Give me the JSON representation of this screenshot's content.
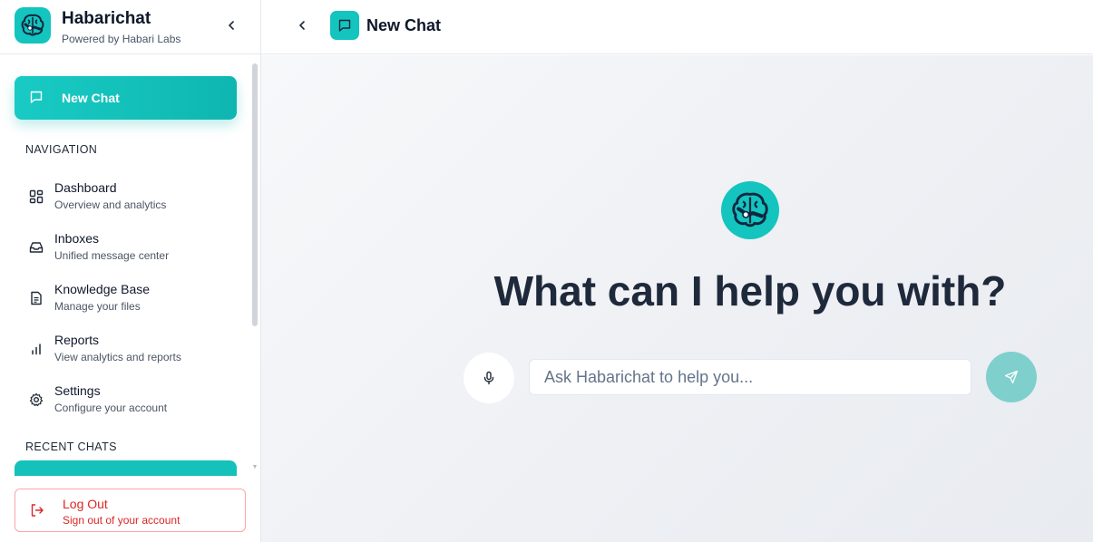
{
  "brand": {
    "name": "Habarichat",
    "subtitle": "Powered by Habari Labs",
    "logo_icon": "brain-handshake-icon",
    "accent_color": "#14c4be"
  },
  "sidebar": {
    "new_chat_label": "New Chat",
    "navigation_title": "NAVIGATION",
    "items": [
      {
        "title": "Dashboard",
        "description": "Overview and analytics",
        "icon": "dashboard-grid-icon"
      },
      {
        "title": "Inboxes",
        "description": "Unified message center",
        "icon": "inbox-icon"
      },
      {
        "title": "Knowledge Base",
        "description": "Manage your files",
        "icon": "file-text-icon"
      },
      {
        "title": "Reports",
        "description": "View analytics and reports",
        "icon": "bar-chart-icon"
      },
      {
        "title": "Settings",
        "description": "Configure your account",
        "icon": "gear-icon"
      }
    ],
    "recent_chats_title": "RECENT CHATS",
    "logout": {
      "title": "Log Out",
      "description": "Sign out of your account",
      "icon": "logout-icon",
      "color": "#dc2626"
    }
  },
  "header": {
    "title": "New Chat"
  },
  "main": {
    "heading": "What can I help you with?",
    "input_placeholder": "Ask Habarichat to help you...",
    "input_value": "",
    "mic_icon": "microphone-icon",
    "send_icon": "send-icon"
  }
}
